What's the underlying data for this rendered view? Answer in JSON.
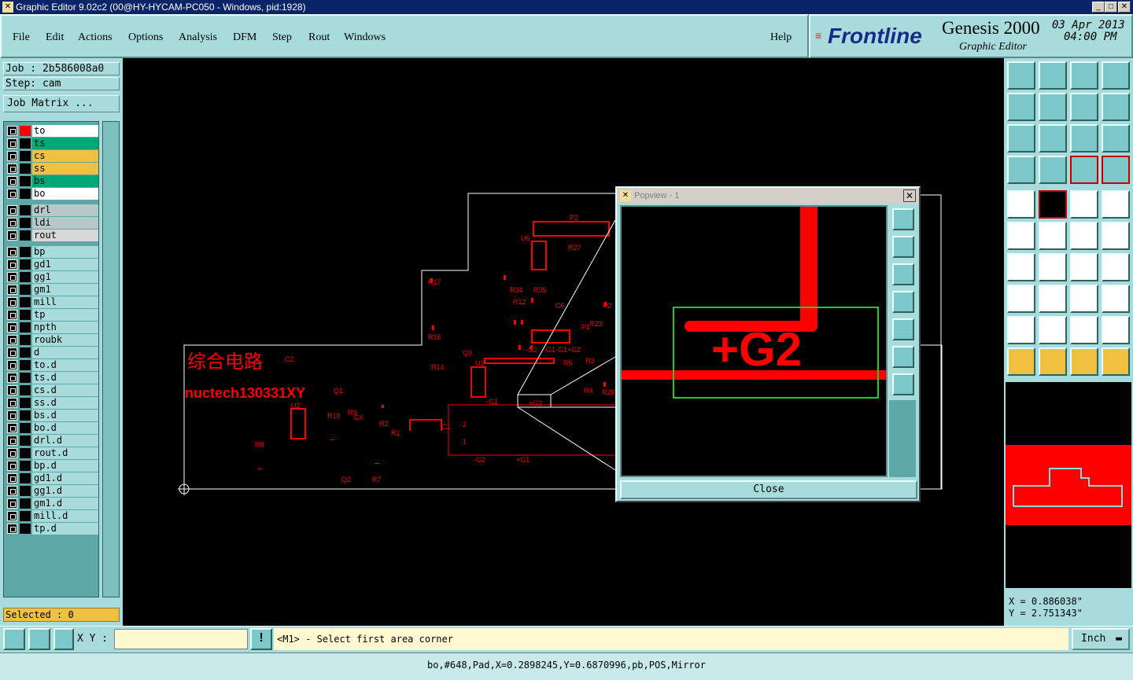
{
  "window": {
    "title": "Graphic Editor 9.02c2 (00@HY-HYCAM-PC050 - Windows, pid:1928)"
  },
  "menu": [
    "File",
    "Edit",
    "Actions",
    "Options",
    "Analysis",
    "DFM",
    "Step",
    "Rout",
    "Windows"
  ],
  "help_label": "Help",
  "brand": {
    "logo": "Frontline",
    "product": "Genesis 2000",
    "subtitle": "Graphic Editor",
    "date": "03 Apr 2013",
    "time": "04:00 PM"
  },
  "job": {
    "job_label": "Job : 2b586008a0",
    "step_label": "Step: cam",
    "matrix_button": "Job Matrix ..."
  },
  "layers": [
    {
      "name": "to",
      "bg": "#ffffff",
      "edit": "✎",
      "colorbox": "#ff0000"
    },
    {
      "name": "ts",
      "bg": "#00a878",
      "edit": ""
    },
    {
      "name": "cs",
      "bg": "#f0c040",
      "edit": "✎"
    },
    {
      "name": "ss",
      "bg": "#f0c040",
      "edit": "✎"
    },
    {
      "name": "bs",
      "bg": "#00a878",
      "edit": ""
    },
    {
      "name": "bo",
      "bg": "#ffffff",
      "edit": "✎"
    },
    {
      "name": "drl",
      "bg": "#b8c8c8",
      "edit": ""
    },
    {
      "name": "ldi",
      "bg": "#b8c8c8",
      "edit": ""
    },
    {
      "name": "rout",
      "bg": "#d8d8d8",
      "edit": ""
    },
    {
      "name": "bp",
      "bg": "#a8dcdc",
      "edit": ""
    },
    {
      "name": "gd1",
      "bg": "#a8dcdc",
      "edit": "✎"
    },
    {
      "name": "gg1",
      "bg": "#a8dcdc",
      "edit": ""
    },
    {
      "name": "gm1",
      "bg": "#a8dcdc",
      "edit": "✎"
    },
    {
      "name": "mill",
      "bg": "#a8dcdc",
      "edit": ""
    },
    {
      "name": "tp",
      "bg": "#a8dcdc",
      "edit": ""
    },
    {
      "name": "npth",
      "bg": "#a8dcdc",
      "edit": ""
    },
    {
      "name": "roubk",
      "bg": "#a8dcdc",
      "edit": ""
    },
    {
      "name": "d",
      "bg": "#a8dcdc",
      "edit": ""
    },
    {
      "name": "to.d",
      "bg": "#a8dcdc",
      "edit": "✎"
    },
    {
      "name": "ts.d",
      "bg": "#a8dcdc",
      "edit": ""
    },
    {
      "name": "cs.d",
      "bg": "#a8dcdc",
      "edit": "✎"
    },
    {
      "name": "ss.d",
      "bg": "#a8dcdc",
      "edit": "✎"
    },
    {
      "name": "bs.d",
      "bg": "#a8dcdc",
      "edit": ""
    },
    {
      "name": "bo.d",
      "bg": "#a8dcdc",
      "edit": "✎"
    },
    {
      "name": "drl.d",
      "bg": "#a8dcdc",
      "edit": ""
    },
    {
      "name": "rout.d",
      "bg": "#a8dcdc",
      "edit": ""
    },
    {
      "name": "bp.d",
      "bg": "#a8dcdc",
      "edit": ""
    },
    {
      "name": "gd1.d",
      "bg": "#a8dcdc",
      "edit": "✎"
    },
    {
      "name": "gg1.d",
      "bg": "#a8dcdc",
      "edit": ""
    },
    {
      "name": "gm1.d",
      "bg": "#a8dcdc",
      "edit": "✎"
    },
    {
      "name": "mill.d",
      "bg": "#a8dcdc",
      "edit": ""
    },
    {
      "name": "tp.d",
      "bg": "#a8dcdc",
      "edit": ""
    }
  ],
  "selected_label": "Selected : 0",
  "board": {
    "chinese_label": "综合电路",
    "part_label": "nuctech130331XY",
    "refdes": [
      "P2",
      "U6",
      "R27",
      "R17",
      "R34",
      "R35",
      "R12",
      "C6",
      "R2",
      "R23",
      "P1",
      "R16",
      "Q3",
      "U1",
      "-G2",
      "-G1",
      "-G1+G2",
      "R5",
      "R3",
      "R14",
      "C2",
      "Q1",
      "U2",
      "R10",
      "R9",
      "C4",
      "R2",
      "R1",
      "C1",
      "R4",
      "R28",
      "-G1",
      "+G2",
      "2",
      "1",
      "-G2",
      "+G1",
      "R8",
      "Q2",
      "R7"
    ]
  },
  "popview": {
    "title": "Popview - 1",
    "label": "+G2",
    "close_label": "Close"
  },
  "coords": {
    "x": "X = 0.886038\"",
    "y": "Y = 2.751343\""
  },
  "bottom": {
    "xy_label": "X Y :",
    "xy_value": "",
    "hint": "<M1> - Select first area corner",
    "units": "Inch"
  },
  "status": "bo,#648,Pad,X=0.2898245,Y=0.6870996,pb,POS,Mirror",
  "colors": {
    "teal_panel": "#a8dcdc",
    "board_red": "#ff0000",
    "highlight_green": "#22cc22",
    "title_blue": "#0a246a"
  }
}
